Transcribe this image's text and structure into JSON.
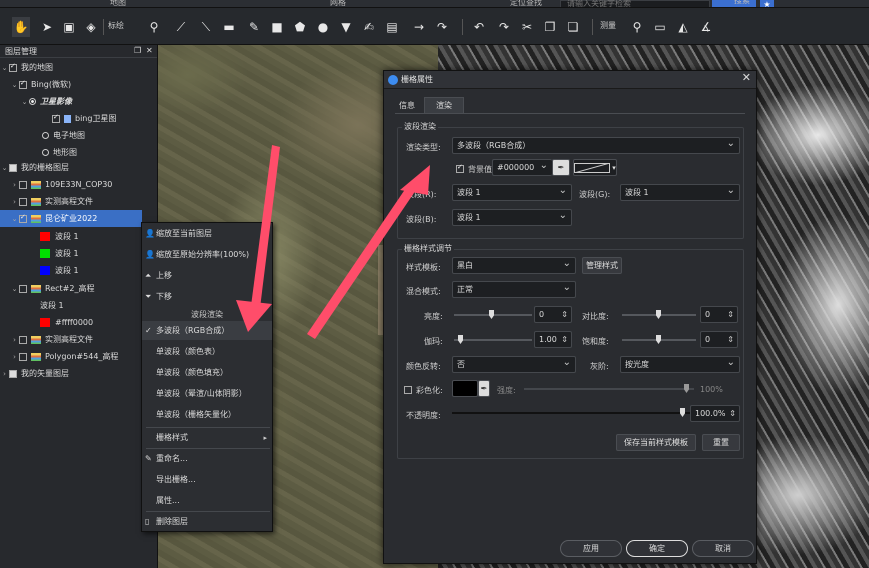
{
  "menubar": {
    "items": [
      "地图",
      "网格",
      "定位查找"
    ],
    "search_placeholder": "请输入关键字检索",
    "search_btn": "搜索"
  },
  "toolbar": {
    "label_mark": "标绘",
    "label_measure": "测量"
  },
  "panel": {
    "title": "图层管理",
    "my_map": "我的地图",
    "bing": "Bing(微软)",
    "sat": "卫星影像",
    "bing_sat": "bing卫星图",
    "e_map": "电子地图",
    "terrain": "地形图",
    "raster_layers": "我的栅格图层",
    "cop30": "109E33N_COP30",
    "dem1": "实测高程文件",
    "mine": "昆仑矿业2022",
    "band1": "波段 1",
    "band2": "波段 1",
    "band3": "波段 1",
    "rect": "Rect#2_高程",
    "rect_band": "波段 1",
    "rect_color": "#ffff0000",
    "dem2": "实测高程文件",
    "polygon": "Polygon#544_高程",
    "vector_layers": "我的矢量图层"
  },
  "menu": {
    "zoom_layer": "缩放至当前图层",
    "zoom_native": "缩放至原始分辨率(100%)",
    "up": "上移",
    "down": "下移",
    "band_render": "波段渲染",
    "multi": "多波段（RGB合成）",
    "single_color": "单波段（颜色表）",
    "single_fill": "单波段（颜色填充）",
    "single_hill": "单波段（晕渲/山体阴影）",
    "single_vector": "单波段（栅格矢量化）",
    "raster_style": "栅格样式",
    "rename": "重命名...",
    "export": "导出栅格...",
    "props": "属性...",
    "delete": "删除图层"
  },
  "dialog": {
    "title": "栅格属性",
    "tab_info": "信息",
    "tab_render": "渲染",
    "grp_band": "波段渲染",
    "render_type_label": "渲染类型:",
    "render_type_value": "多波段（RGB合成）",
    "bg_label": "背景值",
    "bg_value": "#000000",
    "band_r_label": "波段(R):",
    "band_r_value": "波段 1",
    "band_g_label": "波段(G):",
    "band_g_value": "波段 1",
    "band_b_label": "波段(B):",
    "band_b_value": "波段 1",
    "grp_style": "栅格样式调节",
    "style_tpl_label": "样式模板:",
    "style_tpl_value": "黑白",
    "manage_style": "管理样式",
    "blend_label": "混合模式:",
    "blend_value": "正常",
    "brightness_label": "亮度:",
    "brightness_value": "0",
    "contrast_label": "对比度:",
    "contrast_value": "0",
    "gamma_label": "伽玛:",
    "gamma_value": "1.00",
    "saturation_label": "饱和度:",
    "saturation_value": "0",
    "invert_label": "颜色反转:",
    "invert_value": "否",
    "gray_label": "灰阶:",
    "gray_value": "按光度",
    "colorize_label": "彩色化:",
    "strength_label": "强度:",
    "strength_value": "100%",
    "opacity_label": "不透明度:",
    "opacity_value": "100.0%",
    "save_tpl": "保存当前样式模板",
    "reset": "重置",
    "apply": "应用",
    "ok": "确定",
    "cancel": "取消"
  },
  "colors": {
    "accent": "#3a6fc5",
    "arrow": "#ff4d6a",
    "band_red": "#ff0000",
    "band_green": "#00e000",
    "band_blue": "#0000ff"
  }
}
